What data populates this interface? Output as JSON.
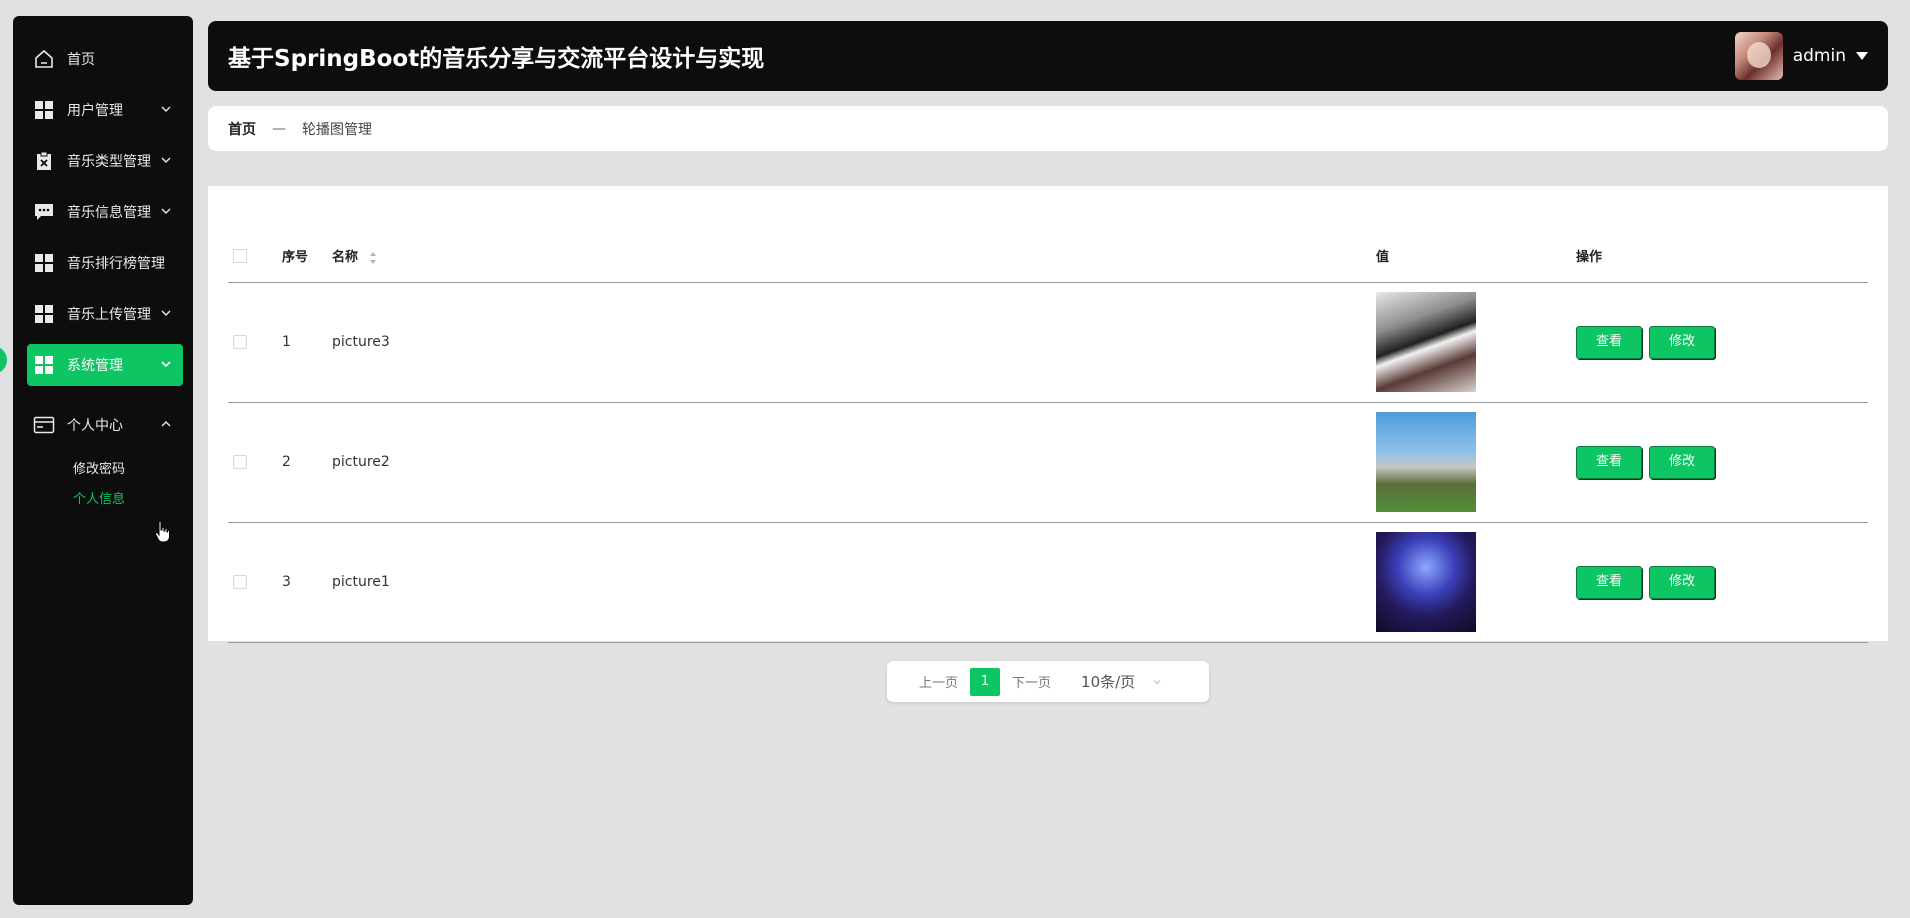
{
  "header": {
    "title": "基于SpringBoot的音乐分享与交流平台设计与实现",
    "username": "admin"
  },
  "sidebar": {
    "items": [
      {
        "label": "首页",
        "icon": "home-icon"
      },
      {
        "label": "用户管理",
        "icon": "grid-icon"
      },
      {
        "label": "音乐类型管理",
        "icon": "clipboard-x-icon"
      },
      {
        "label": "音乐信息管理",
        "icon": "chat-icon"
      },
      {
        "label": "音乐排行榜管理",
        "icon": "grid-icon"
      },
      {
        "label": "音乐上传管理",
        "icon": "grid-icon"
      },
      {
        "label": "系统管理",
        "icon": "grid-icon",
        "active": true
      }
    ],
    "group": {
      "label": "个人中心",
      "icon": "wallet-icon",
      "children": [
        {
          "label": "修改密码"
        },
        {
          "label": "个人信息",
          "active": true
        }
      ]
    }
  },
  "breadcrumb": {
    "home": "首页",
    "separator": "—",
    "current": "轮播图管理"
  },
  "table": {
    "columns": [
      "序号",
      "名称",
      "值",
      "操作"
    ],
    "rows": [
      {
        "index": "1",
        "name": "picture3",
        "image": "piano-keys-photo"
      },
      {
        "index": "2",
        "name": "picture2",
        "image": "building-lawn-photo"
      },
      {
        "index": "3",
        "name": "picture1",
        "image": "concert-hall-photo"
      }
    ],
    "actions": {
      "view": "查看",
      "edit": "修改"
    }
  },
  "pagination": {
    "prev": "上一页",
    "current": "1",
    "next": "下一页",
    "page_size": "10条/页"
  },
  "colors": {
    "accent": "#0ec563",
    "dark": "#0d0d0d",
    "background": "#e1e1e1"
  }
}
